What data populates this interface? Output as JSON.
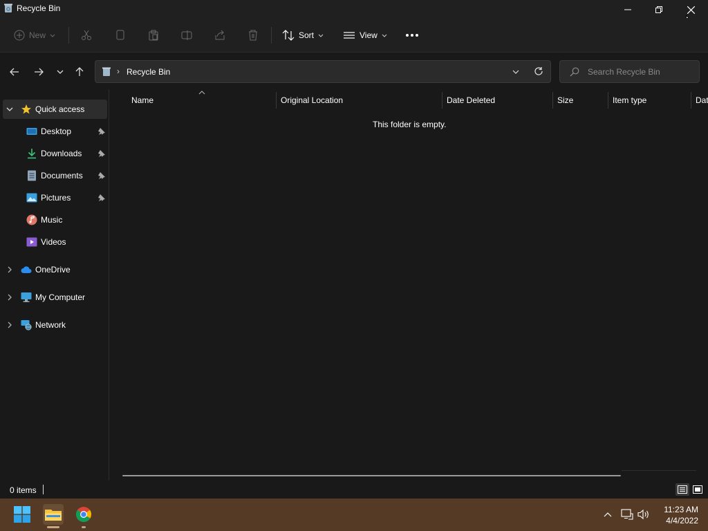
{
  "window": {
    "title": "Recycle Bin"
  },
  "toolbar": {
    "new_label": "New",
    "sort_label": "Sort",
    "view_label": "View",
    "more_label": "See more",
    "icons": [
      "cut-icon",
      "copy-icon",
      "paste-icon",
      "rename-icon",
      "share-icon",
      "delete-icon"
    ]
  },
  "address": {
    "crumbs": [
      "Recycle Bin"
    ],
    "search_placeholder": "Search Recycle Bin"
  },
  "sidebar": {
    "quick_access": "Quick access",
    "quick_items": [
      {
        "label": "Desktop",
        "pinned": true
      },
      {
        "label": "Downloads",
        "pinned": true
      },
      {
        "label": "Documents",
        "pinned": true
      },
      {
        "label": "Pictures",
        "pinned": true
      },
      {
        "label": "Music",
        "pinned": false
      },
      {
        "label": "Videos",
        "pinned": false
      }
    ],
    "roots": [
      {
        "label": "OneDrive"
      },
      {
        "label": "My Computer"
      },
      {
        "label": "Network"
      }
    ]
  },
  "content": {
    "columns": [
      "Name",
      "Original Location",
      "Date Deleted",
      "Size",
      "Item type",
      "Dat"
    ],
    "empty_message": "This folder is empty."
  },
  "status": {
    "item_count": "0 items"
  },
  "taskbar": {
    "apps": [
      "start-icon",
      "file-explorer-icon",
      "chrome-icon"
    ],
    "time": "11:23 AM",
    "date": "4/4/2022"
  },
  "colors": {
    "window_bg": "#191919",
    "chrome_bg": "#202020",
    "taskbar_bg": "#553b26",
    "accent": "#4aa3ff"
  }
}
